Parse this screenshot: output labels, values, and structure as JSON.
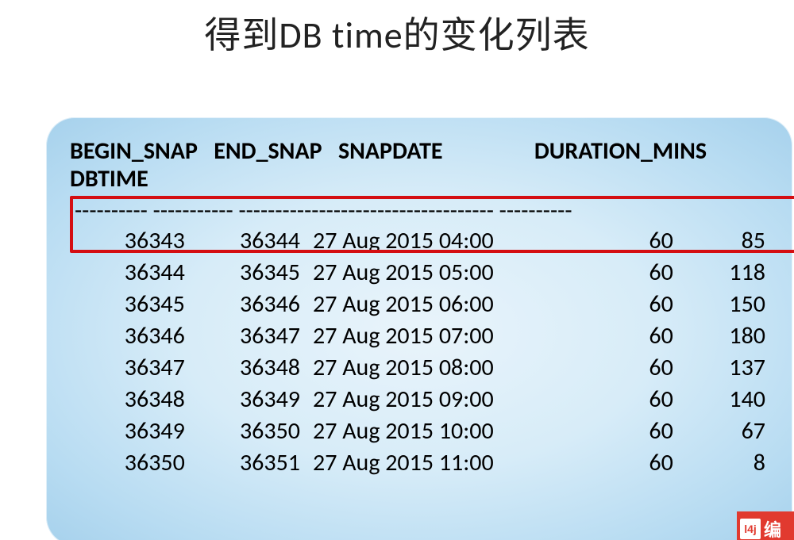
{
  "title": "得到DB time的变化列表",
  "header_line1": "BEGIN_SNAP   END_SNAP   SNAPDATE                 DURATION_MINS",
  "header_line2": "DBTIME",
  "separator": "---------- ----------- ----------------------------------- ----------",
  "columns": [
    "BEGIN_SNAP",
    "END_SNAP",
    "SNAPDATE",
    "DURATION_MINS",
    "DBTIME"
  ],
  "rows": [
    {
      "begin": "36343",
      "end": "36344",
      "date": "27 Aug 2015 04:00",
      "dur": "60",
      "dbtime": "85"
    },
    {
      "begin": "36344",
      "end": "36345",
      "date": "27 Aug 2015 05:00",
      "dur": "60",
      "dbtime": "118"
    },
    {
      "begin": "36345",
      "end": "36346",
      "date": "27 Aug 2015 06:00",
      "dur": "60",
      "dbtime": "150"
    },
    {
      "begin": "36346",
      "end": "36347",
      "date": "27 Aug 2015 07:00",
      "dur": "60",
      "dbtime": "180"
    },
    {
      "begin": "36347",
      "end": "36348",
      "date": "27 Aug 2015 08:00",
      "dur": "60",
      "dbtime": "137"
    },
    {
      "begin": "36348",
      "end": "36349",
      "date": "27 Aug 2015 09:00",
      "dur": "60",
      "dbtime": "140"
    },
    {
      "begin": "36349",
      "end": "36350",
      "date": "27 Aug 2015 10:00",
      "dur": "60",
      "dbtime": "67"
    },
    {
      "begin": "36350",
      "end": "36351",
      "date": "27 Aug 2015 11:00",
      "dur": "60",
      "dbtime": "8"
    }
  ],
  "logo_badge": "l4j",
  "logo_text": "编"
}
